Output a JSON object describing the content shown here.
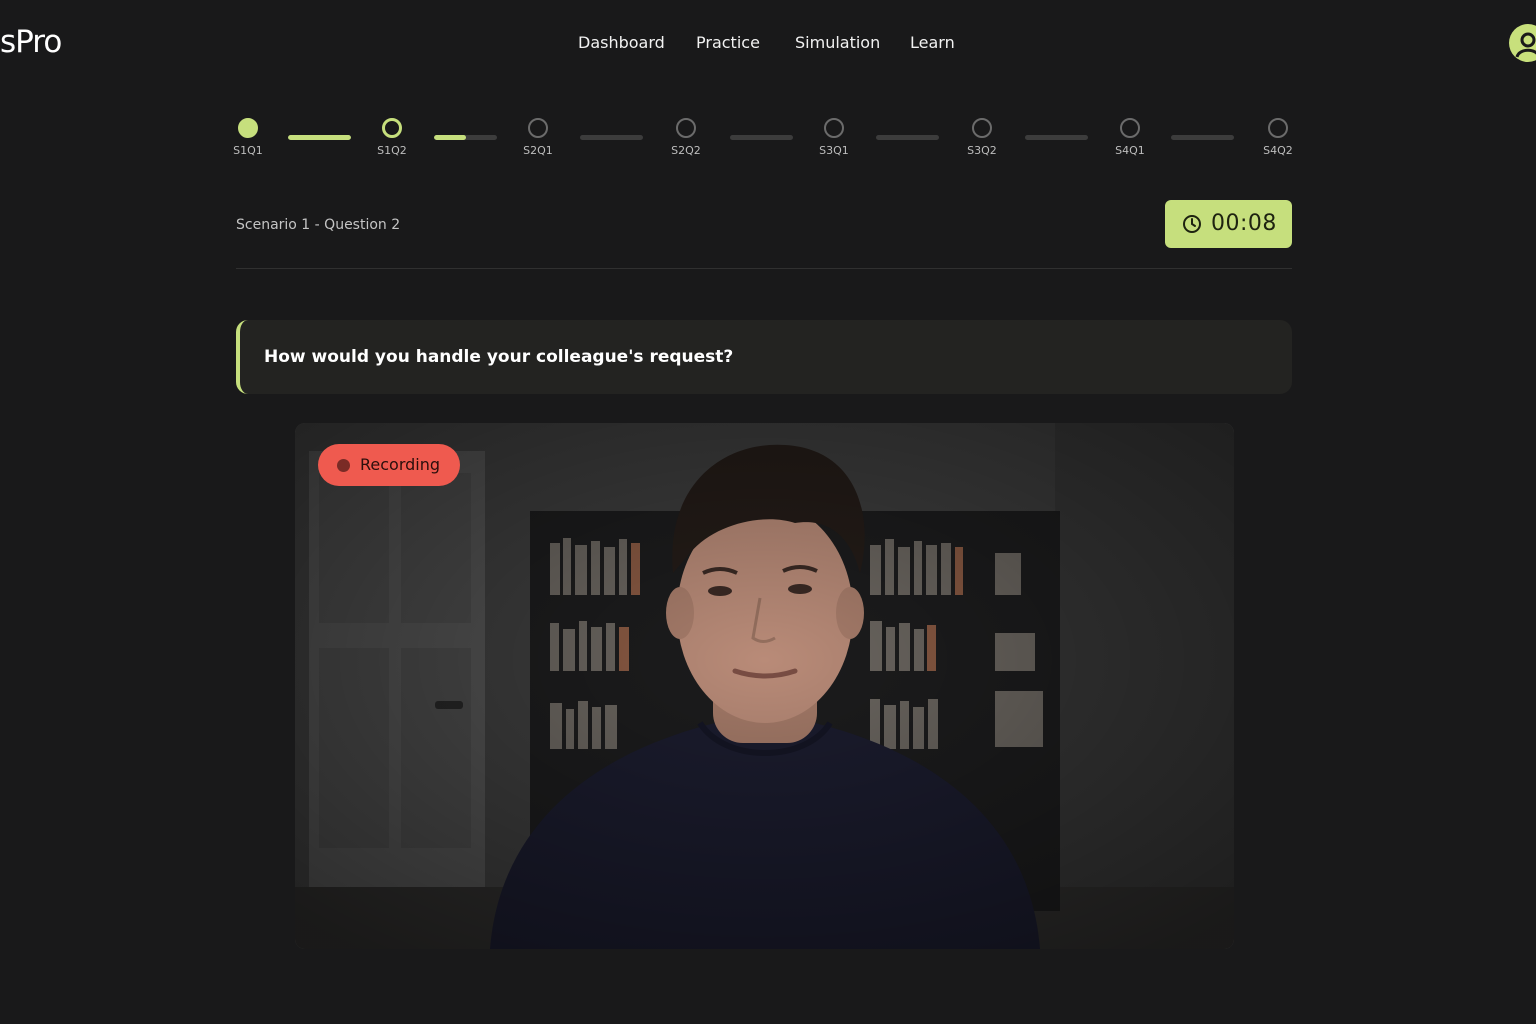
{
  "app": {
    "logo_text": "sPro"
  },
  "nav": {
    "items": [
      "Dashboard",
      "Practice",
      "Simulation",
      "Learn"
    ]
  },
  "user": {
    "avatar_icon": "user-icon"
  },
  "progress": {
    "accent_color": "#c6df7d",
    "steps": [
      {
        "label": "S1Q1",
        "status": "done"
      },
      {
        "label": "S1Q2",
        "status": "current"
      },
      {
        "label": "S2Q1",
        "status": "pending"
      },
      {
        "label": "S2Q2",
        "status": "pending"
      },
      {
        "label": "S3Q1",
        "status": "pending"
      },
      {
        "label": "S3Q2",
        "status": "pending"
      },
      {
        "label": "S4Q1",
        "status": "pending"
      },
      {
        "label": "S4Q2",
        "status": "pending"
      }
    ],
    "connector_fill": [
      1,
      0.5,
      0,
      0,
      0,
      0,
      0
    ]
  },
  "question_header": {
    "title": "Scenario 1 - Question 2"
  },
  "timer": {
    "icon": "clock-icon",
    "value": "00:08"
  },
  "question": {
    "text": "How would you handle your colleague's request?"
  },
  "video": {
    "recording_label": "Recording",
    "recording_color": "#ef5a4f"
  }
}
